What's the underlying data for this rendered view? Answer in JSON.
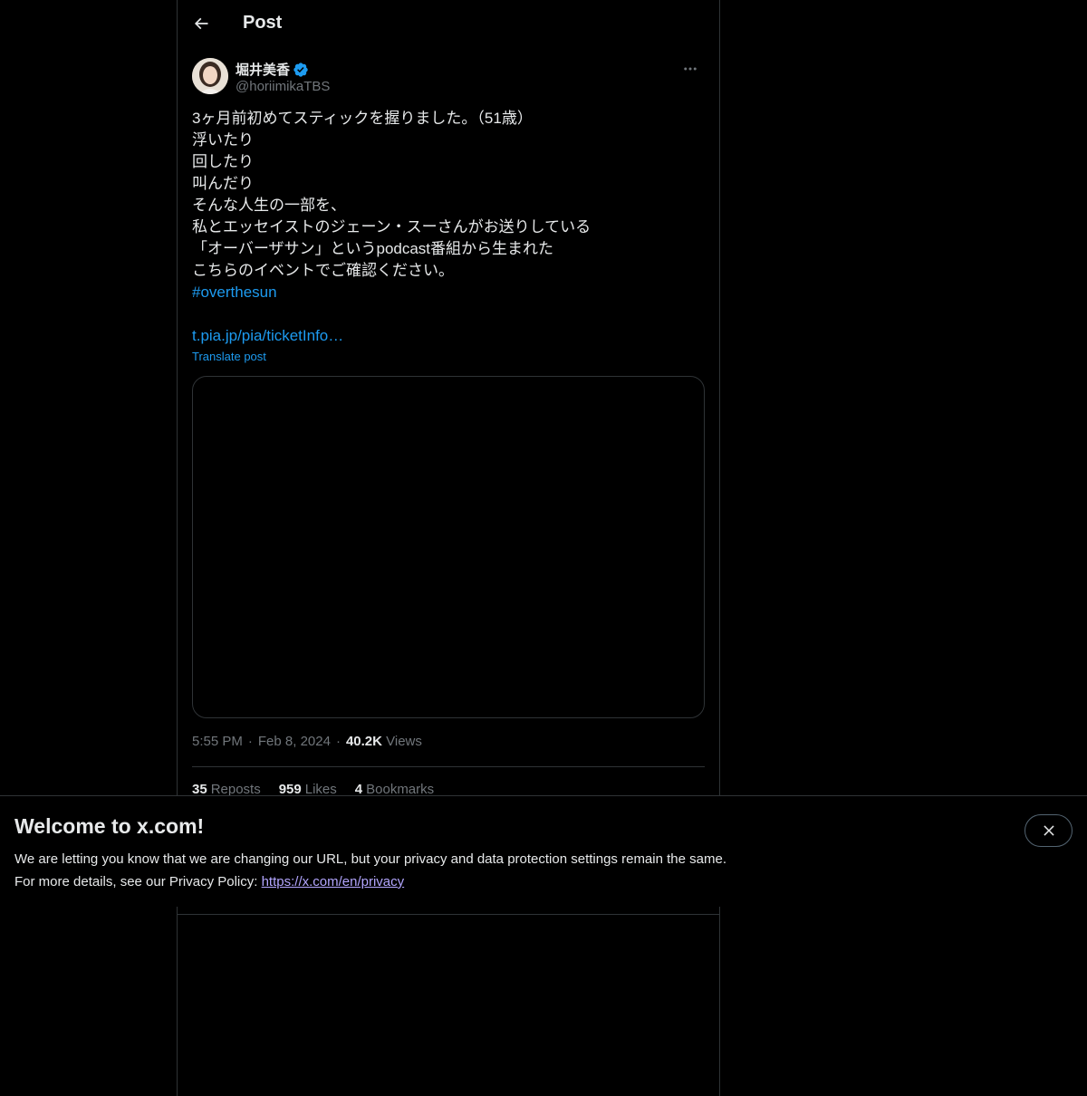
{
  "header": {
    "title": "Post"
  },
  "author": {
    "name": "堀井美香",
    "handle": "@horiimikaTBS"
  },
  "tweet": {
    "lines": [
      "3ヶ月前初めてスティックを握りました。（51歳）",
      "浮いたり",
      "回したり",
      "叫んだり",
      "そんな人生の一部を、",
      "私とエッセイストのジェーン・スーさんがお送りしている",
      "「オーバーザサン」というpodcast番組から生まれた",
      "こちらのイベントでご確認ください。"
    ],
    "hashtag": "#overthesun",
    "link": "t.pia.jp/pia/ticketInfo…",
    "translate_label": "Translate post"
  },
  "meta": {
    "time": "5:55 PM",
    "date": "Feb 8, 2024",
    "views_count": "40.2K",
    "views_label": "Views",
    "separator": "·"
  },
  "stats": {
    "reposts_count": "35",
    "reposts_label": "Reposts",
    "likes_count": "959",
    "likes_label": "Likes",
    "bookmarks_count": "4",
    "bookmarks_label": "Bookmarks"
  },
  "banner": {
    "title": "Welcome to x.com!",
    "line1": "We are letting you know that we are changing our URL, but your privacy and data protection settings remain the same.",
    "line2_prefix": "For more details, see our Privacy Policy: ",
    "link": "https://x.com/en/privacy"
  },
  "colors": {
    "background": "#000000",
    "text": "#e7e9ea",
    "secondary": "#71767b",
    "accent": "#1d9bf0",
    "border": "#2f3336",
    "verified": "#1d9bf0"
  }
}
